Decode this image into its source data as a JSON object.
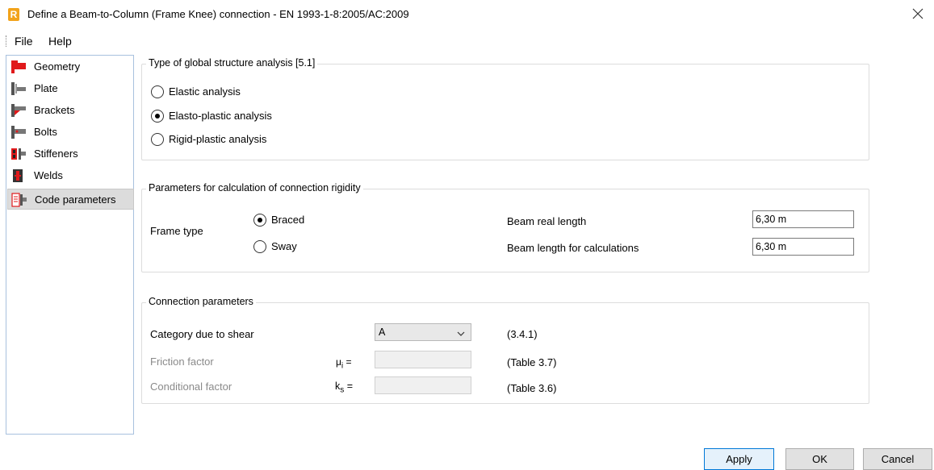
{
  "window": {
    "app_icon_letter": "R",
    "title": "Define a Beam-to-Column (Frame Knee) connection - EN 1993-1-8:2005/AC:2009",
    "close_icon": "close-icon"
  },
  "menu": [
    "File",
    "Help"
  ],
  "sidebar": {
    "items": [
      {
        "label": "Geometry",
        "icon": "geometry-icon"
      },
      {
        "label": "Plate",
        "icon": "plate-icon"
      },
      {
        "label": "Brackets",
        "icon": "brackets-icon"
      },
      {
        "label": "Bolts",
        "icon": "bolts-icon"
      },
      {
        "label": "Stiffeners",
        "icon": "stiffeners-icon"
      },
      {
        "label": "Welds",
        "icon": "welds-icon"
      },
      {
        "label": "Code parameters",
        "icon": "code-parameters-icon",
        "selected": true
      }
    ]
  },
  "analysis": {
    "title": "Type of global structure analysis [5.1]",
    "options": [
      "Elastic analysis",
      "Elasto-plastic analysis",
      "Rigid-plastic analysis"
    ],
    "selected": "Elasto-plastic analysis"
  },
  "rigidity": {
    "title": "Parameters for calculation of connection rigidity",
    "frame_type_label": "Frame type",
    "options": [
      "Braced",
      "Sway"
    ],
    "selected": "Braced",
    "beam_real_length_label": "Beam real length",
    "beam_real_length_value": "6,30 m",
    "beam_calc_length_label": "Beam length for calculations",
    "beam_calc_length_value": "6,30 m"
  },
  "connection": {
    "title": "Connection parameters",
    "category_label": "Category due to shear",
    "category_value": "A",
    "category_ref": "(3.4.1)",
    "friction_label": "Friction factor",
    "friction_symbol": "μ",
    "friction_sub": "i",
    "friction_eq": "=",
    "friction_value": "",
    "friction_ref": "(Table 3.7)",
    "conditional_label": "Conditional factor",
    "conditional_symbol": "k",
    "conditional_sub": "s",
    "conditional_eq": "=",
    "conditional_value": "",
    "conditional_ref": "(Table 3.6)"
  },
  "buttons": {
    "apply": "Apply",
    "ok": "OK",
    "cancel": "Cancel"
  },
  "colors": {
    "accent": "#0078d7",
    "app_icon": "#f2a31b",
    "selected_bg": "#dcdcdc",
    "icon_red": "#e0191b"
  }
}
